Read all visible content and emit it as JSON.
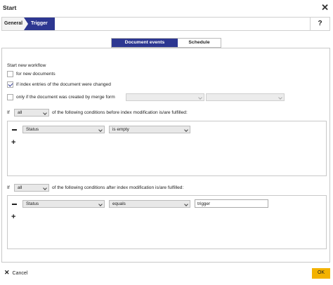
{
  "window": {
    "title": "Start",
    "close_icon": "close-icon"
  },
  "breadcrumb": {
    "items": [
      "General",
      "Trigger"
    ],
    "help_label": "?"
  },
  "tabs": [
    {
      "label": "Document events",
      "active": true
    },
    {
      "label": "Schedule",
      "active": false
    }
  ],
  "workflow": {
    "heading": "Start new workflow",
    "options": [
      {
        "label": "for new documents",
        "checked": false
      },
      {
        "label": "if index entries of the document were changed",
        "checked": true
      },
      {
        "label": "only if the document was created by merge form",
        "checked": false
      }
    ]
  },
  "conditions_before": {
    "if_label": "If",
    "quantifier": "all",
    "text": "of the following conditions before index modification is/are fulfilled:",
    "rows": [
      {
        "field": "Status",
        "operator": "is empty"
      }
    ]
  },
  "conditions_after": {
    "if_label": "If",
    "quantifier": "all",
    "text": "of the following conditions after index modification is/are fulfilled:",
    "rows": [
      {
        "field": "Status",
        "operator": "equals",
        "value": "trigger"
      }
    ]
  },
  "footer": {
    "cancel_label": "Cancel",
    "ok_label": "OK"
  },
  "colors": {
    "accent": "#2d3791",
    "ok_button": "#f3b200"
  }
}
